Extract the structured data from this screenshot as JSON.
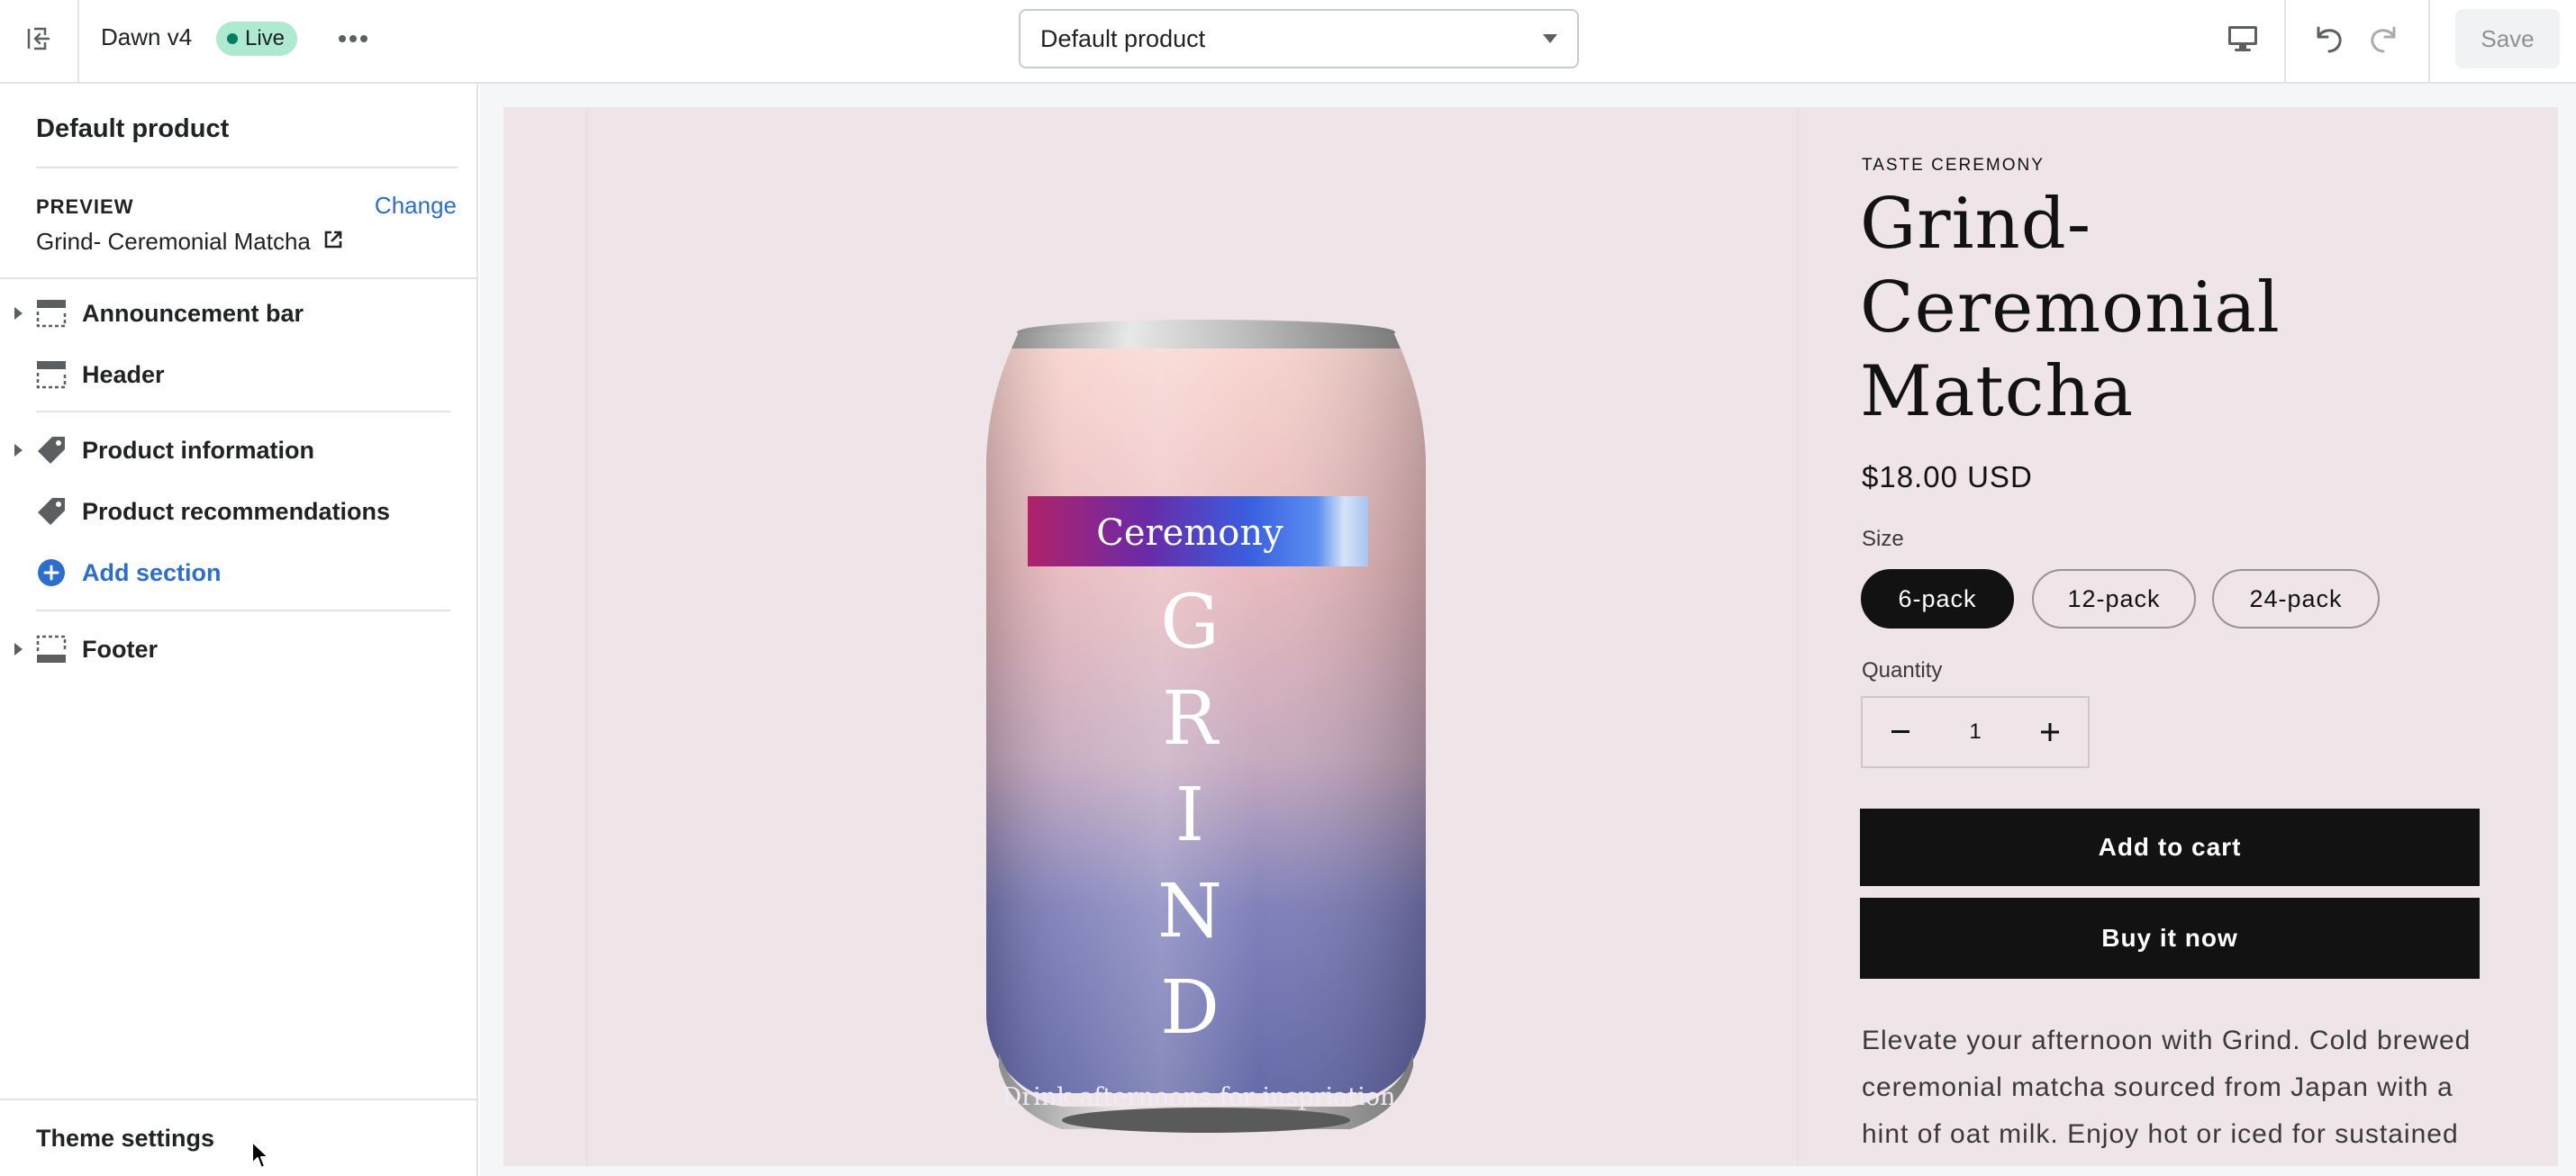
{
  "topbar": {
    "theme_name": "Dawn v4",
    "status_badge": "Live",
    "template_select": "Default product",
    "save_label": "Save"
  },
  "sidebar": {
    "title": "Default product",
    "preview_label": "PREVIEW",
    "change_label": "Change",
    "preview_product": "Grind- Ceremonial Matcha",
    "sections": [
      {
        "label": "Announcement bar",
        "icon": "layout-header-icon",
        "expandable": true
      },
      {
        "label": "Header",
        "icon": "layout-header-icon",
        "expandable": false
      },
      {
        "label": "Product information",
        "icon": "tag-icon",
        "expandable": true
      },
      {
        "label": "Product recommendations",
        "icon": "tag-icon",
        "expandable": false
      },
      {
        "label": "Add section",
        "icon": "plus-circle-icon",
        "expandable": false
      },
      {
        "label": "Footer",
        "icon": "layout-footer-icon",
        "expandable": true
      }
    ],
    "theme_settings": "Theme settings"
  },
  "product": {
    "vendor": "TASTE CEREMONY",
    "title": "Grind- Ceremonial Matcha",
    "price": "$18.00 USD",
    "size_label": "Size",
    "sizes": [
      "6-pack",
      "12-pack",
      "24-pack"
    ],
    "selected_size": "6-pack",
    "quantity_label": "Quantity",
    "quantity": "1",
    "add_to_cart": "Add to cart",
    "buy_now": "Buy it now",
    "description": "Elevate your afternoon with Grind. Cold brewed ceremonial matcha sourced from Japan with a hint of oat milk. Enjoy hot or iced for sustained",
    "can_label_band": "Ceremony",
    "can_letters": [
      "G",
      "R",
      "I",
      "N",
      "D"
    ],
    "can_tagline": "Drink afternoons for inspriation"
  },
  "colors": {
    "accent": "#2c6ecb",
    "live_badge": "#aee9d1",
    "store_background": "#efe4e7",
    "primary_button": "#121212"
  }
}
